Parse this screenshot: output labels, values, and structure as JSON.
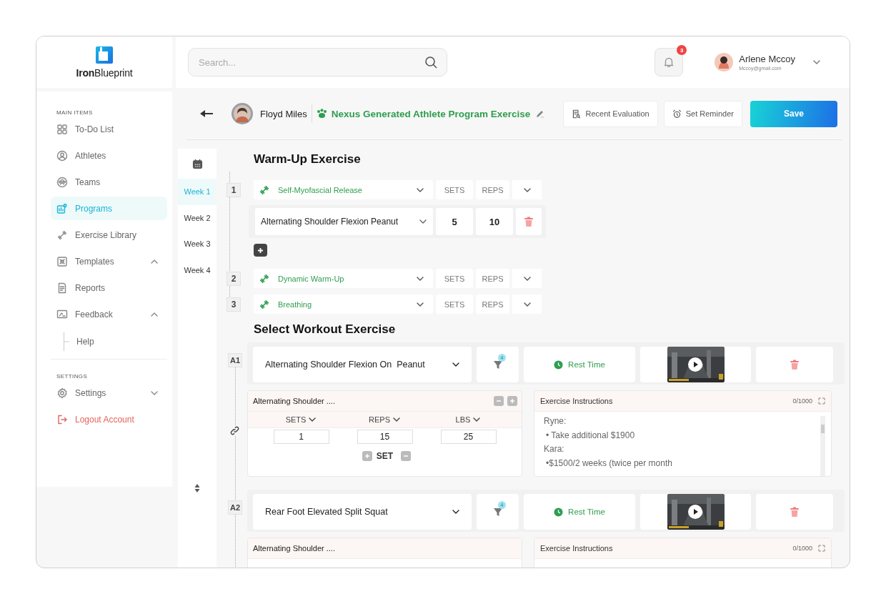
{
  "brand": {
    "name": "**Iron**Blueprint"
  },
  "sidebar": {
    "sections": [
      {
        "heading": "MAIN ITEMS",
        "items": [
          {
            "label": "To-Do List",
            "kind": "link",
            "selected": false
          },
          {
            "label": "Athletes",
            "kind": "link",
            "selected": false
          },
          {
            "label": "Teams",
            "kind": "link",
            "selected": false
          },
          {
            "label": "Programs",
            "kind": "link",
            "selected": true
          },
          {
            "label": "Exercise Library",
            "kind": "link",
            "selected": false
          },
          {
            "label": "Templates",
            "kind": "group",
            "selected": false,
            "expanded": true
          },
          {
            "label": "Reports",
            "kind": "link",
            "selected": false
          },
          {
            "label": "Feedback",
            "kind": "group",
            "selected": false,
            "expanded": true,
            "children": [
              {
                "label": "Help",
                "selected": false
              }
            ]
          }
        ]
      },
      {
        "heading": "SETTINGS",
        "items": [
          {
            "label": "Settings",
            "kind": "group",
            "selected": false,
            "expanded": false
          },
          {
            "label": "Logout Account",
            "kind": "logout",
            "selected": false
          }
        ]
      }
    ]
  },
  "topbar": {
    "search": {
      "placeholder": "Search..."
    },
    "notifications": {
      "count": "3"
    },
    "user": {
      "name": "Arlene Mccoy",
      "email": "Mccoy@gmail.com"
    }
  },
  "header": {
    "athlete": "Floyd Miles",
    "program_title": "Nexus Generated Athlete Program Exercise",
    "buttons": [
      {
        "label": "Recent Evaluation",
        "kind": "evaluation"
      },
      {
        "label": "Set Reminder",
        "kind": "reminder"
      },
      {
        "label": "Save",
        "kind": "primary"
      }
    ]
  },
  "weeks": [
    {
      "label": "Week 1",
      "selected": true
    },
    {
      "label": "Week 2",
      "selected": false
    },
    {
      "label": "Week 3",
      "selected": false
    },
    {
      "label": "Week 4",
      "selected": false
    }
  ],
  "warmup": {
    "title": "Warm-Up Exercise",
    "items": [
      {
        "number": "1",
        "name": "Self-Myofascial Release",
        "sets": {
          "placeholder": "SETS"
        },
        "reps": {
          "placeholder": "REPS"
        },
        "exercises": [
          {
            "name": "Alternating Shoulder Flexion Peanut",
            "sets": "5",
            "reps": "10"
          }
        ]
      },
      {
        "number": "2",
        "name": "Dynamic Warm-Up",
        "sets": {
          "placeholder": "SETS"
        },
        "reps": {
          "placeholder": "REPS"
        }
      },
      {
        "number": "3",
        "name": "Breathing",
        "sets": {
          "placeholder": "SETS"
        },
        "reps": {
          "placeholder": "REPS"
        }
      }
    ]
  },
  "workout": {
    "title": "Select Workout Exercise",
    "groups": [
      {
        "label": "A1",
        "exercise": "Alternating Shoulder Flexion On  Peanut",
        "variations": "4",
        "rest_label": "Rest Time",
        "sets_card": {
          "title": "Alternating Shoulder ....",
          "columns": [
            "SETS",
            "REPS",
            "LBS"
          ],
          "values": [
            "1",
            "15",
            "25"
          ],
          "add_label": "SET"
        },
        "instructions": {
          "title": "Exercise Instructions",
          "counter": "0/1000",
          "lines": [
            "Ryne:",
            "• Take additional $1900",
            "Kara:",
            "•$1500/2 weeks (twice per month"
          ]
        }
      },
      {
        "label": "A2",
        "exercise": "Rear Foot Elevated Split Squat",
        "variations": "4",
        "rest_label": "Rest Time",
        "sets_card": {
          "title": "Alternating Shoulder ...."
        },
        "instructions": {
          "title": "Exercise Instructions",
          "counter": "0/1000"
        }
      }
    ]
  }
}
